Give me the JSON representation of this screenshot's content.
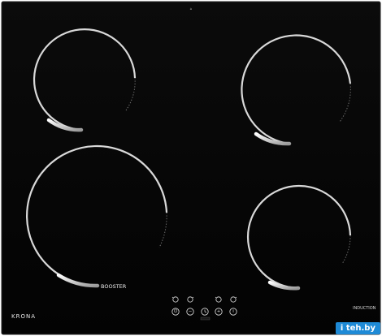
{
  "product": {
    "brand": "KRONA",
    "booster_label": "BOOSTER",
    "technology_label": "INDUCTION",
    "model_label": "",
    "glass_color": "#050505",
    "ring_color": "#bdbdbd",
    "accent_color": "#cfcfcf"
  },
  "cooking_zones": [
    {
      "id": "rear-left",
      "label": ""
    },
    {
      "id": "rear-right",
      "label": ""
    },
    {
      "id": "front-left",
      "label": "BOOSTER"
    },
    {
      "id": "front-right",
      "label": ""
    }
  ],
  "controls": {
    "top_row": [
      "timer-zone-1",
      "timer-zone-2",
      "timer-zone-3",
      "timer-zone-4"
    ],
    "bottom_row": [
      "power-icon",
      "minus-icon",
      "timer-icon",
      "plus-icon",
      "lock-icon"
    ],
    "glyphs": {
      "minus": "−",
      "plus": "+",
      "power": "⏻",
      "info": "i"
    }
  },
  "watermark": {
    "text": "i teh.by"
  }
}
